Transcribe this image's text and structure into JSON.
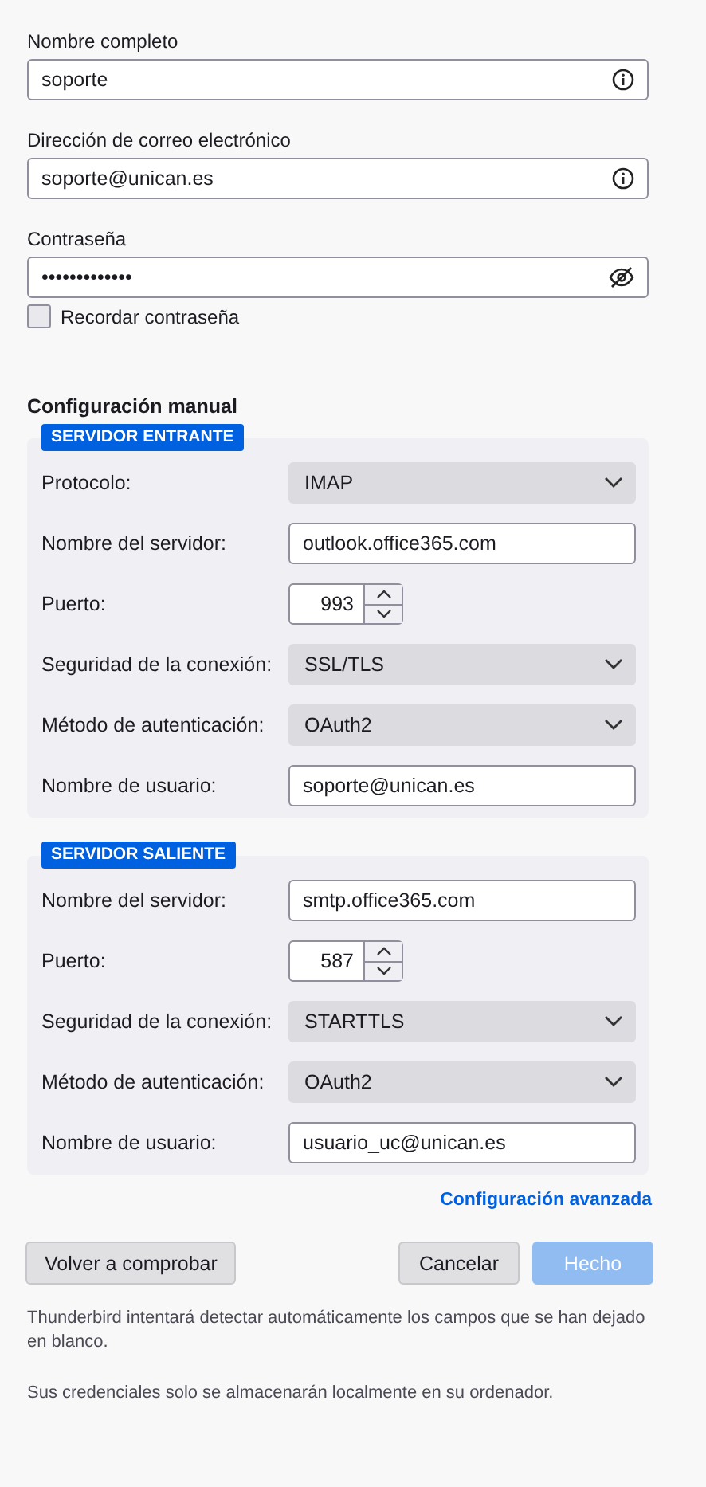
{
  "account": {
    "fields": [
      {
        "kind": "info",
        "label": "Nombre completo",
        "value": "soporte"
      },
      {
        "kind": "info",
        "label": "Dirección de correo electrónico",
        "value": "soporte@unican.es"
      },
      {
        "kind": "password",
        "label": "Contraseña",
        "value": "•••••••••••••"
      }
    ],
    "remember": {
      "label": "Recordar contraseña",
      "checked": false
    }
  },
  "manual": {
    "title": "Configuración manual",
    "servers": [
      {
        "badge": "SERVIDOR ENTRANTE",
        "rows": [
          {
            "kind": "select",
            "label": "Protocolo:",
            "value": "IMAP"
          },
          {
            "kind": "text",
            "label": "Nombre del servidor:",
            "value": "outlook.office365.com"
          },
          {
            "kind": "port",
            "label": "Puerto:",
            "value": "993"
          },
          {
            "kind": "select",
            "label": "Seguridad de la conexión:",
            "value": "SSL/TLS"
          },
          {
            "kind": "select",
            "label": "Método de autenticación:",
            "value": "OAuth2"
          },
          {
            "kind": "text",
            "label": "Nombre de usuario:",
            "value": "soporte@unican.es"
          }
        ]
      },
      {
        "badge": "SERVIDOR SALIENTE",
        "rows": [
          {
            "kind": "text",
            "label": "Nombre del servidor:",
            "value": "smtp.office365.com"
          },
          {
            "kind": "port",
            "label": "Puerto:",
            "value": "587"
          },
          {
            "kind": "select",
            "label": "Seguridad de la conexión:",
            "value": "STARTTLS"
          },
          {
            "kind": "select",
            "label": "Método de autenticación:",
            "value": "OAuth2"
          },
          {
            "kind": "text",
            "label": "Nombre de usuario:",
            "value": "usuario_uc@unican.es"
          }
        ]
      }
    ],
    "advanced_link": "Configuración avanzada"
  },
  "buttons": [
    {
      "label": "Volver a comprobar",
      "kind": "secondary",
      "disabled": false
    },
    {
      "label": "Cancelar",
      "kind": "secondary",
      "disabled": false
    },
    {
      "label": "Hecho",
      "kind": "primary",
      "disabled": true
    }
  ],
  "notes": [
    "Thunderbird intentará detectar automáticamente los campos que se han dejado en blanco.",
    "Sus credenciales solo se almacenarán localmente en su ordenador."
  ]
}
